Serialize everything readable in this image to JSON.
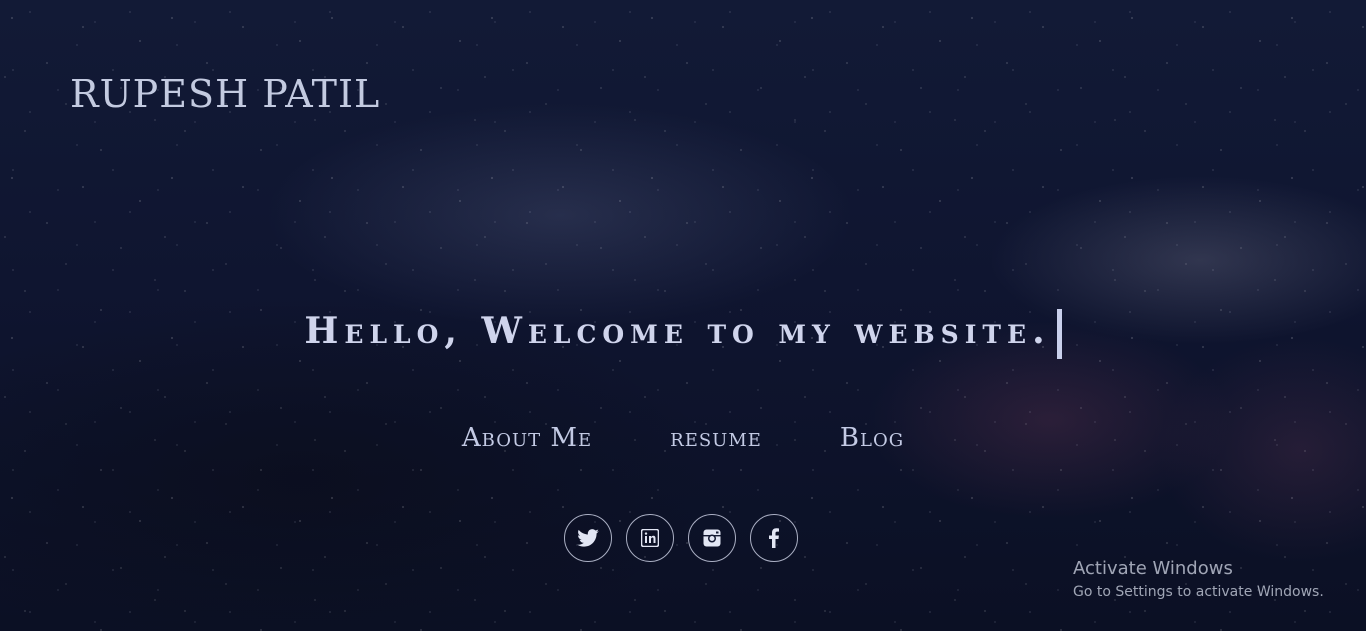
{
  "site": {
    "logo_text": "RUPESH PATIL"
  },
  "hero": {
    "headline": "Hello, Welcome to my website."
  },
  "nav": {
    "items": [
      {
        "label": "About Me"
      },
      {
        "label": "resume"
      },
      {
        "label": "Blog"
      }
    ]
  },
  "social": {
    "items": [
      {
        "icon": "twitter-icon"
      },
      {
        "icon": "linkedin-icon"
      },
      {
        "icon": "instagram-icon"
      },
      {
        "icon": "facebook-icon"
      }
    ]
  },
  "os_watermark": {
    "title": "Activate Windows",
    "subtitle": "Go to Settings to activate Windows."
  },
  "colors": {
    "background": "#0d1226",
    "text": "#c8cfe8"
  }
}
